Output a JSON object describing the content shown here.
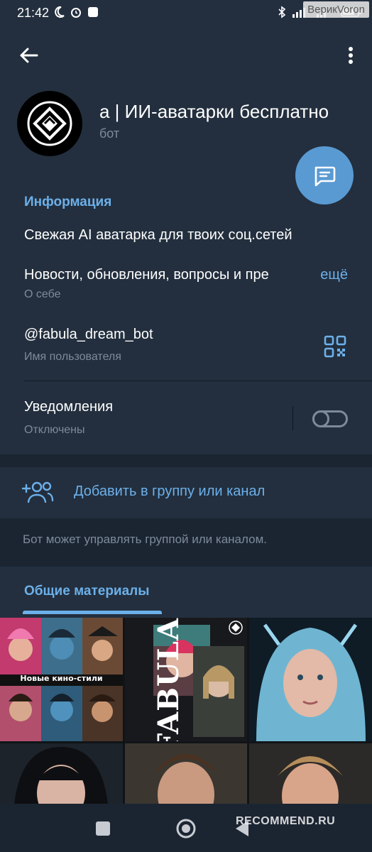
{
  "status_bar": {
    "time": "21:42",
    "watermark": "ВерикVoron"
  },
  "header": {
    "title": "а | ИИ-аватарки бесплатно",
    "subtitle": "бот",
    "icons": {
      "back": "arrow-left-icon",
      "more": "more-vertical-icon",
      "fab": "message-icon"
    }
  },
  "info": {
    "section_title": "Информация",
    "description_line1": "Свежая AI аватарка для твоих соц.сетей",
    "description_line2": "Новости, обновления, вопросы и пре",
    "more_link": "ещё",
    "about_label": "О себе",
    "username": "@fabula_dream_bot",
    "username_label": "Имя пользователя",
    "notifications": "Уведомления",
    "notifications_state": "Отключены",
    "notifications_enabled": false
  },
  "actions": {
    "add_to_group": "Добавить в группу или канал",
    "hint": "Бот может управлять группой или каналом."
  },
  "media": {
    "tab_label": "Общие материалы",
    "tile1_caption": "Новые кино-стили",
    "tile2_word": "FABULA"
  },
  "bottom": {
    "watermark": "RECOMMEND.RU"
  },
  "colors": {
    "accent": "#6cb0ea",
    "surface": "#232f3e",
    "background": "#1b2532",
    "secondary_text": "#7d8b99",
    "fab": "#5a9ad3"
  }
}
